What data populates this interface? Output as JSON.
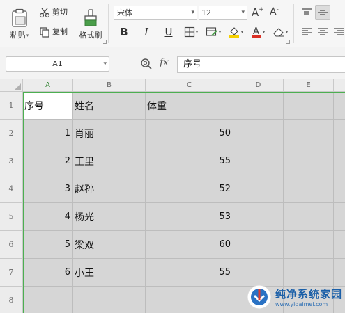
{
  "ribbon": {
    "paste_label": "粘贴",
    "cut_label": "剪切",
    "copy_label": "复制",
    "format_painter_label": "格式刷",
    "font_name": "宋体",
    "font_size": "12",
    "bold": "B",
    "italic": "I",
    "underline": "U",
    "grow_font": "A⁺",
    "shrink_font": "A⁻"
  },
  "formula_bar": {
    "name_box": "A1",
    "fx_label": "fx",
    "formula_value": "序号"
  },
  "columns": [
    "A",
    "B",
    "C",
    "D",
    "E"
  ],
  "rows": [
    "1",
    "2",
    "3",
    "4",
    "5",
    "6",
    "7",
    "8"
  ],
  "table": {
    "header": [
      "序号",
      "姓名",
      "体重"
    ],
    "data": [
      [
        "1",
        "肖丽",
        "50"
      ],
      [
        "2",
        "王里",
        "55"
      ],
      [
        "3",
        "赵孙",
        "52"
      ],
      [
        "4",
        "杨光",
        "53"
      ],
      [
        "5",
        "梁双",
        "60"
      ],
      [
        "6",
        "小王",
        "55"
      ]
    ]
  },
  "watermark": {
    "title": "纯净系统家园",
    "url": "www.yidaimei.com"
  },
  "colors": {
    "selection_accent": "#4caf50",
    "cell_fill": "#d6d6d6",
    "underline_red": "#d93025",
    "highlight_yellow": "#f5d000"
  }
}
